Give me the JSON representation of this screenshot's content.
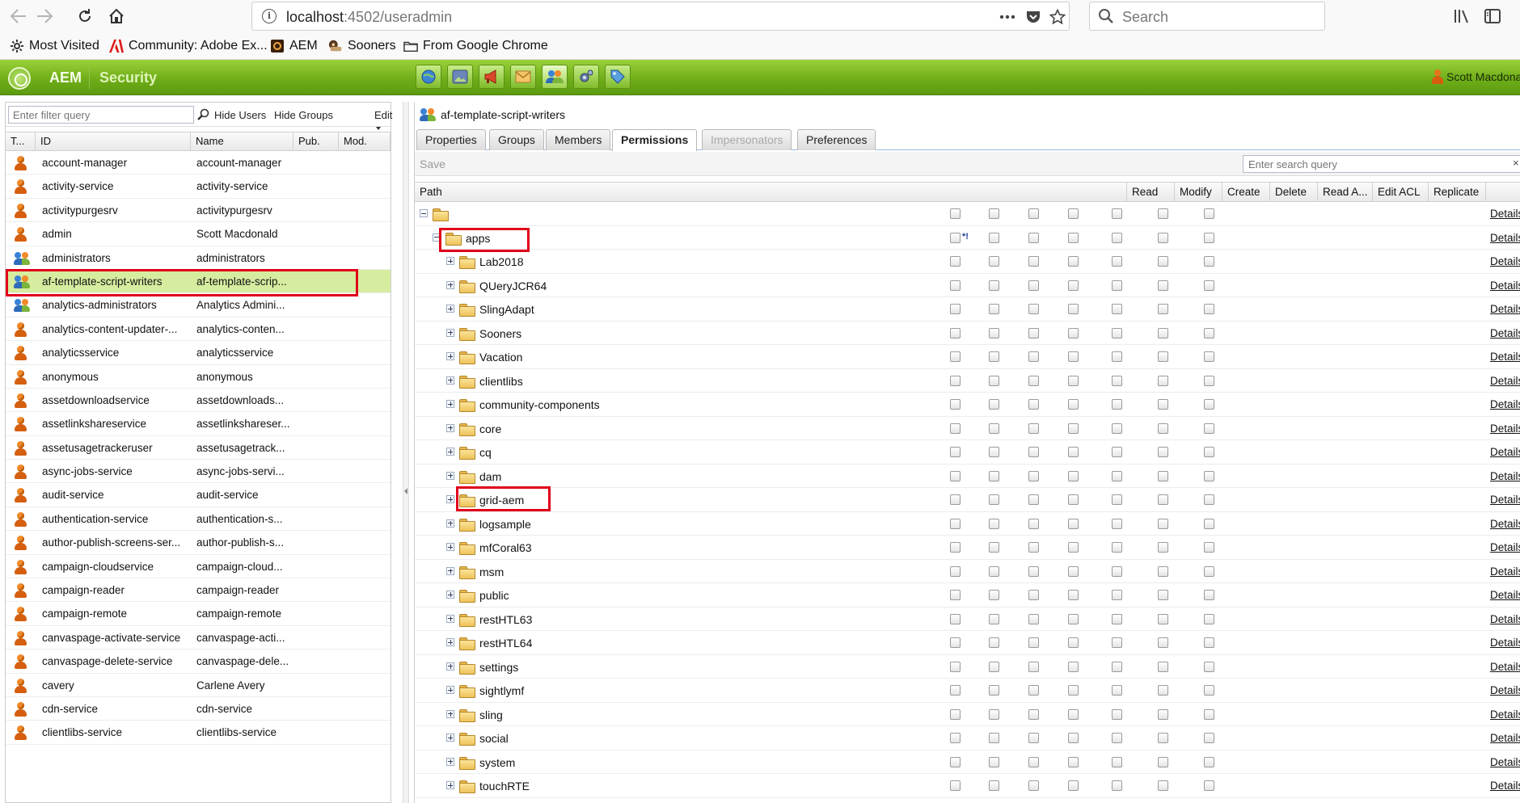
{
  "browser": {
    "url_host": "localhost",
    "url_path": ":4502/useradmin",
    "search_placeholder": "Search",
    "bookmarks": [
      "Most Visited",
      "Community: Adobe Ex...",
      "AEM",
      "Sooners",
      "From Google Chrome"
    ]
  },
  "header": {
    "product": "AEM",
    "section": "Security",
    "user": "Scott Macdona"
  },
  "left_panel": {
    "filter_placeholder": "Enter filter query",
    "hide_users": "Hide Users",
    "hide_groups": "Hide Groups",
    "edit": "Edit",
    "columns": [
      "T...",
      "ID",
      "Name",
      "Pub.",
      "Mod."
    ],
    "rows": [
      {
        "type": "user",
        "id": "account-manager",
        "name": "account-manager"
      },
      {
        "type": "user",
        "id": "activity-service",
        "name": "activity-service"
      },
      {
        "type": "user",
        "id": "activitypurgesrv",
        "name": "activitypurgesrv"
      },
      {
        "type": "user",
        "id": "admin",
        "name": "Scott Macdonald"
      },
      {
        "type": "group",
        "id": "administrators",
        "name": "administrators"
      },
      {
        "type": "group",
        "id": "af-template-script-writers",
        "name": "af-template-scrip..."
      },
      {
        "type": "group",
        "id": "analytics-administrators",
        "name": "Analytics Admini..."
      },
      {
        "type": "user",
        "id": "analytics-content-updater-...",
        "name": "analytics-conten..."
      },
      {
        "type": "user",
        "id": "analyticsservice",
        "name": "analyticsservice"
      },
      {
        "type": "user",
        "id": "anonymous",
        "name": "anonymous"
      },
      {
        "type": "user",
        "id": "assetdownloadservice",
        "name": "assetdownloads..."
      },
      {
        "type": "user",
        "id": "assetlinkshareservice",
        "name": "assetlinkshareser..."
      },
      {
        "type": "user",
        "id": "assetusagetrackeruser",
        "name": "assetusagetrack..."
      },
      {
        "type": "user",
        "id": "async-jobs-service",
        "name": "async-jobs-servi..."
      },
      {
        "type": "user",
        "id": "audit-service",
        "name": "audit-service"
      },
      {
        "type": "user",
        "id": "authentication-service",
        "name": "authentication-s..."
      },
      {
        "type": "user",
        "id": "author-publish-screens-ser...",
        "name": "author-publish-s..."
      },
      {
        "type": "user",
        "id": "campaign-cloudservice",
        "name": "campaign-cloud..."
      },
      {
        "type": "user",
        "id": "campaign-reader",
        "name": "campaign-reader"
      },
      {
        "type": "user",
        "id": "campaign-remote",
        "name": "campaign-remote"
      },
      {
        "type": "user",
        "id": "canvaspage-activate-service",
        "name": "canvaspage-acti..."
      },
      {
        "type": "user",
        "id": "canvaspage-delete-service",
        "name": "canvaspage-dele..."
      },
      {
        "type": "user",
        "id": "cavery",
        "name": "Carlene Avery"
      },
      {
        "type": "user",
        "id": "cdn-service",
        "name": "cdn-service"
      },
      {
        "type": "user",
        "id": "clientlibs-service",
        "name": "clientlibs-service"
      }
    ]
  },
  "right_panel": {
    "title": "af-template-script-writers",
    "tabs": [
      "Properties",
      "Groups",
      "Members",
      "Permissions",
      "Impersonators",
      "Preferences"
    ],
    "save": "Save",
    "search_placeholder": "Enter search query",
    "columns": [
      "Path",
      "Read",
      "Modify",
      "Create",
      "Delete",
      "Read A...",
      "Edit ACL",
      "Replicate"
    ],
    "details_label": "Details",
    "apps_marker": "*!",
    "rows": [
      "",
      "apps",
      "Lab2018",
      "QUeryJCR64",
      "SlingAdapt",
      "Sooners",
      "Vacation",
      "clientlibs",
      "community-components",
      "core",
      "cq",
      "dam",
      "grid-aem",
      "logsample",
      "mfCoral63",
      "msm",
      "public",
      "restHTL63",
      "restHTL64",
      "settings",
      "sightlymf",
      "sling",
      "social",
      "system",
      "touchRTE"
    ]
  }
}
